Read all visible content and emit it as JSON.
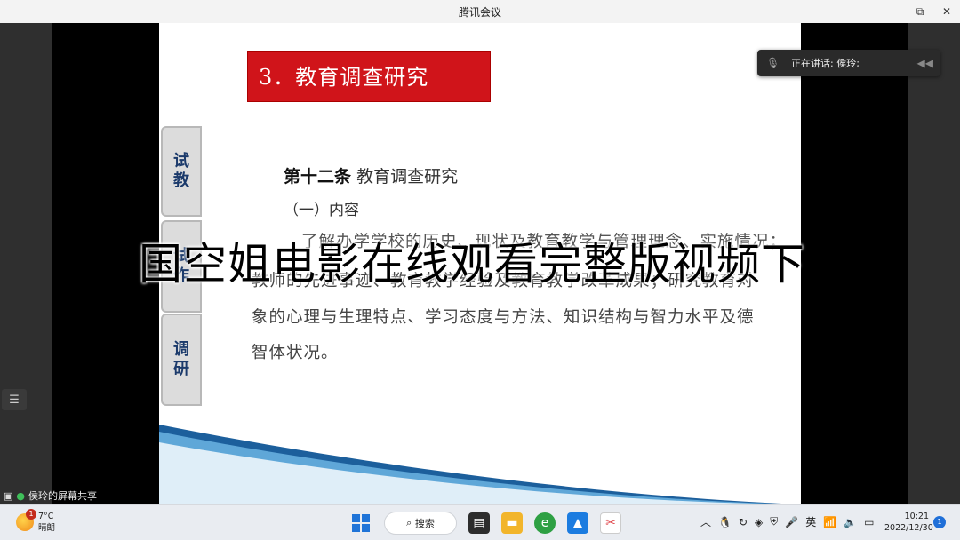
{
  "window": {
    "title": "腾讯会议",
    "minimize": "—",
    "restore": "⧉",
    "close": "✕"
  },
  "slide": {
    "title": "3．教育调查研究",
    "tabs": [
      {
        "label_a": "试",
        "label_b": "教"
      },
      {
        "label_a": "试",
        "label_b": "作"
      },
      {
        "label_a": "调",
        "label_b": "研"
      }
    ],
    "article_heading": "第十二条",
    "article_title": "教育调查研究",
    "subheading": "（一）内容",
    "lines": [
      "了解办学学校的历史、现状及教育教学与管理理念、实施情况；",
      "教师的先进事迹、教育教学经验及教育教学改革成果；研究教育对",
      "象的心理与生理特点、学习态度与方法、知识结构与智力水平及德",
      "智体状况。"
    ]
  },
  "overlay_text": "国空姐电影在线观看完整版视频下",
  "speaker": {
    "label": "正在讲话: 侯玲;"
  },
  "share": {
    "label": "侯玲的屏幕共享"
  },
  "taskbar": {
    "weather_temp": "7°C",
    "weather_desc": "晴朗",
    "weather_badge": "1",
    "search_label": "搜索",
    "ime": "英",
    "time": "10:21",
    "date": "2022/12/30",
    "notifications": "1"
  }
}
